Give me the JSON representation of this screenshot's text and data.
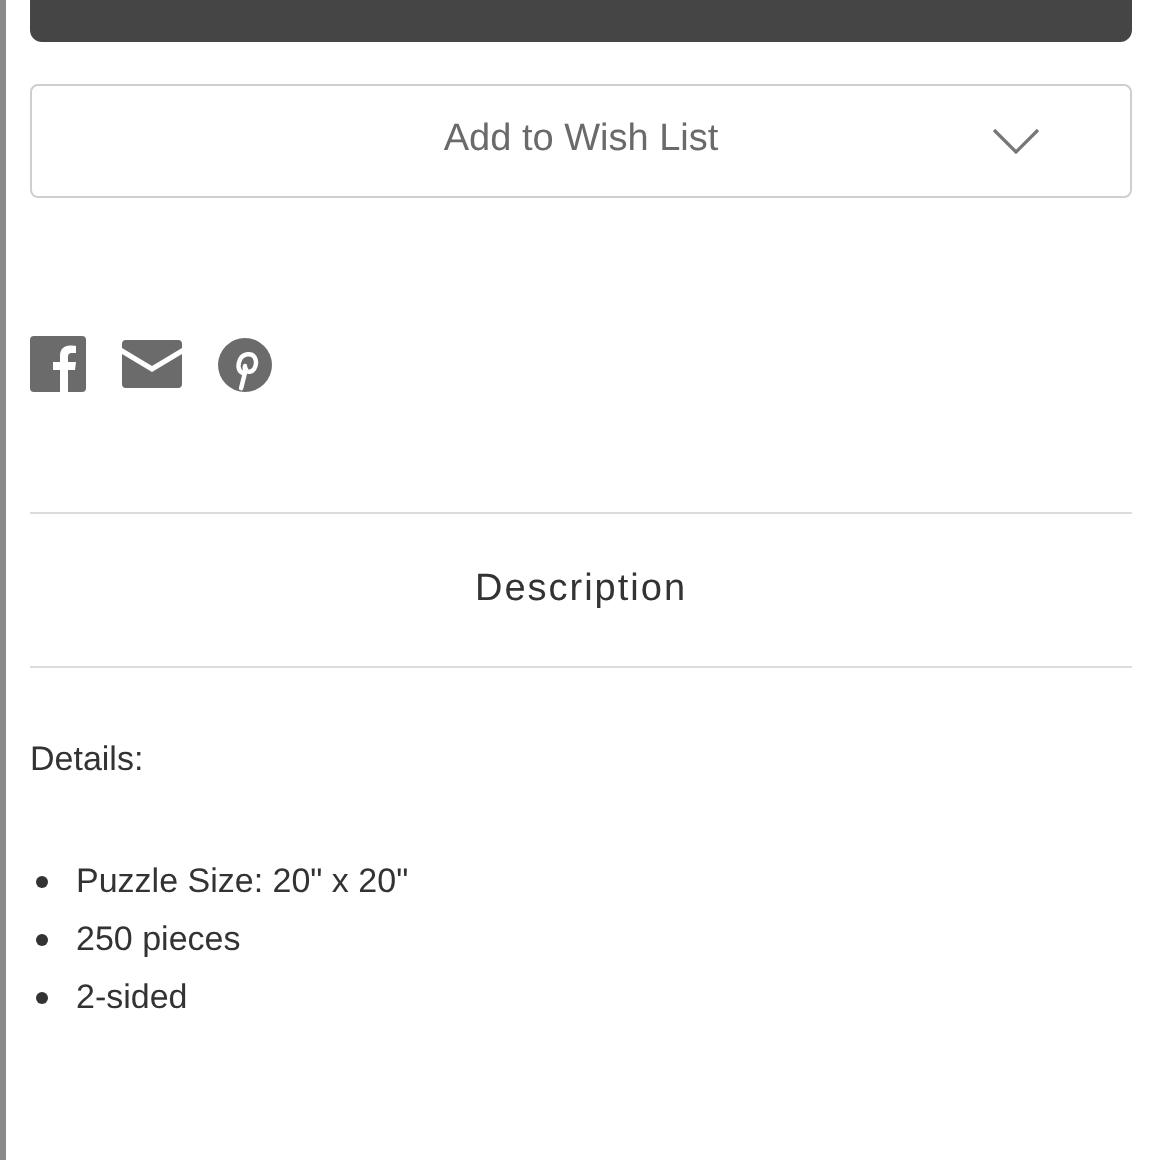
{
  "wishlist_button": {
    "label": "Add to Wish List"
  },
  "share_icons": [
    {
      "kind": "facebook"
    },
    {
      "kind": "email"
    },
    {
      "kind": "pinterest"
    }
  ],
  "description_tab": {
    "label": "Description"
  },
  "details": {
    "heading": "Details:",
    "items": [
      "Puzzle Size: 20\" x 20\"",
      "250 pieces",
      "2-sided"
    ]
  }
}
